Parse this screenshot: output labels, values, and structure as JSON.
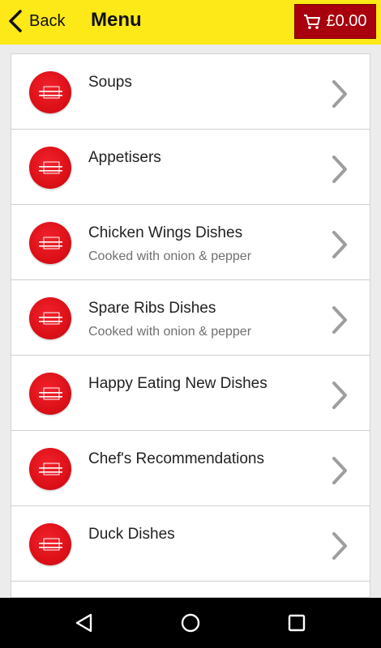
{
  "header": {
    "back_label": "Back",
    "title": "Menu",
    "cart_total": "£0.00"
  },
  "menu": {
    "items": [
      {
        "label": "Soups",
        "subtitle": ""
      },
      {
        "label": "Appetisers",
        "subtitle": ""
      },
      {
        "label": "Chicken Wings Dishes",
        "subtitle": "Cooked with onion & pepper"
      },
      {
        "label": "Spare Ribs Dishes",
        "subtitle": "Cooked with onion & pepper"
      },
      {
        "label": "Happy Eating New Dishes",
        "subtitle": ""
      },
      {
        "label": "Chef's Recommendations",
        "subtitle": ""
      },
      {
        "label": "Duck Dishes",
        "subtitle": ""
      },
      {
        "label": "",
        "subtitle": ""
      }
    ]
  },
  "theme": {
    "header_bg": "#fde818",
    "cart_bg": "#a8000c",
    "logo_red": "#dd1018",
    "chevron": "#9e9e9e"
  },
  "icons": {
    "back": "chevron-left-icon",
    "cart": "shopping-cart-icon",
    "item_logo": "happy-eating-logo",
    "item_arrow": "chevron-right-icon",
    "nav_back": "triangle-back-icon",
    "nav_home": "circle-home-icon",
    "nav_recents": "square-recents-icon"
  }
}
